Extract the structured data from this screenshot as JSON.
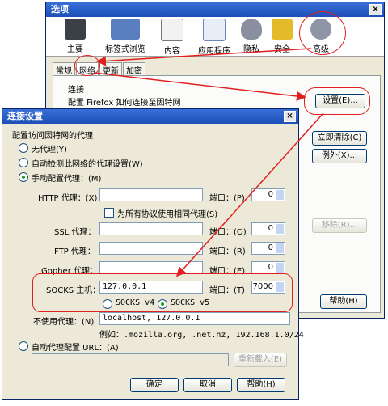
{
  "options_window": {
    "title": "选项",
    "close": "×",
    "toolbar": [
      "主要",
      "标签式浏览",
      "内容",
      "应用程序",
      "隐私",
      "安全",
      "高级"
    ],
    "tabs": [
      "常规",
      "网络",
      "更新",
      "加密"
    ],
    "connection_group": "连接",
    "connection_desc": "配置 Firefox 如何连接至因特网",
    "settings_button": "设置(E)...",
    "clear_now_button": "立即清除(C)",
    "exceptions_button": "例外(X)...",
    "remove_button": "移除(R)...",
    "help_button": "帮助(H)"
  },
  "dialog": {
    "title": "连接设置",
    "close": "×",
    "group_label": "配置访问因特网的代理",
    "no_proxy": "无代理(Y)",
    "auto_detect": "自动检测此网络的代理设置(W)",
    "manual": "手动配置代理：(M)",
    "http_label": "HTTP 代理：(X)",
    "http_value": "",
    "port_label": "端口：(P)",
    "port_http": "0",
    "same_proxy": "为所有协议使用相同代理(S)",
    "ssl_label": "SSL 代理：",
    "ssl_value": "",
    "port_label_ssl": "端口：(O)",
    "port_ssl": "0",
    "ftp_label": "FTP 代理：",
    "ftp_value": "",
    "port_label_ftp": "端口：(R)",
    "port_ftp": "0",
    "gopher_label": "Gopher 代理：",
    "gopher_value": "",
    "port_label_gopher": "端口：(E)",
    "port_gopher": "0",
    "socks_label": "SOCKS 主机：",
    "socks_value": "127.0.0.1",
    "port_label_socks": "端口：(T)",
    "port_socks": "7000",
    "socks_v4": "SOCKS v4",
    "socks_v5": "SOCKS v5",
    "no_proxy_for_label": "不使用代理：(N)",
    "no_proxy_for_value": "localhost, 127.0.0.1",
    "example": "例如：.mozilla.org, .net.nz, 192.168.1.0/24",
    "auto_url_label": "自动代理配置 URL：(A)",
    "auto_url_value": "",
    "reload_button": "重新载入(E)",
    "ok_button": "确定",
    "cancel_button": "取消",
    "help_button": "帮助(H)"
  },
  "colors": {
    "highlight": "#e02020",
    "titlebar": "#1c4fb8"
  }
}
